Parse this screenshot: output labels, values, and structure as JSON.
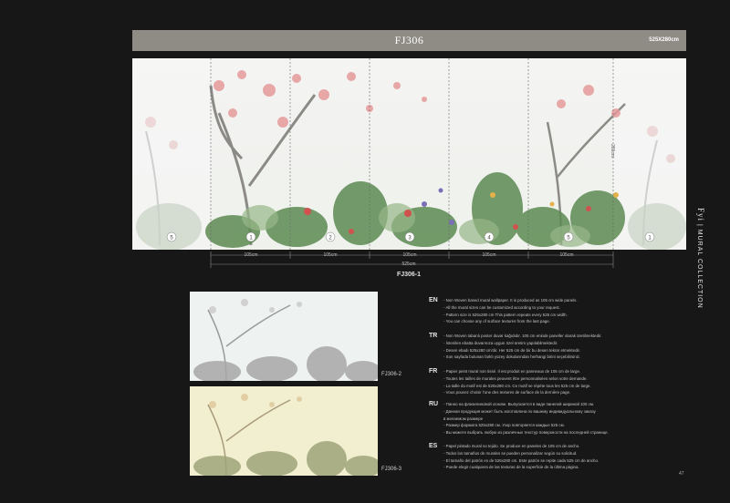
{
  "header": {
    "title": "FJ306",
    "size": "525X280cm"
  },
  "mural": {
    "panel_markers": [
      "5",
      "1",
      "2",
      "3",
      "4",
      "5",
      "1"
    ],
    "height_label": "280cm",
    "panel_widths": [
      "105cm",
      "105cm",
      "105cm",
      "105cm",
      "105cm"
    ],
    "total_width": "525cm",
    "code": "FJ306-1"
  },
  "variants": [
    {
      "code": "FJ306-2"
    },
    {
      "code": "FJ306-3"
    }
  ],
  "brand": {
    "name": "Fyi",
    "separator": "|",
    "collection": "MURAL COLLECTION"
  },
  "descriptions": [
    {
      "code": "EN",
      "lines": [
        "- Non Woven based mural wallpaper. It is produced as 105 cm wide panels.",
        "- All the mural sizes can be customized according to  your request.",
        "- Pattern size is 525x280 cm  This pattern repeats every 525 cm width.",
        "- You can choose any of surface textures from  the last page."
      ]
    },
    {
      "code": "TR",
      "lines": [
        "- Non Woven tabanlı poster duvar kağıdıdır. 105 cm eninde paneller olarak üretilmektedir.",
        "- İstenilen ebatta duvarınıza uygun  özel üretim yapılabilmektedir.",
        "- Desen ebadı 525x280 cm'dir.  Her 525 cm de bir bu desen tekrar etmektedir.",
        "- Son sayfada bulunan farklı yüzey dokularından herhangi birini seçebilirsiniz."
      ]
    },
    {
      "code": "FR",
      "lines": [
        "- Papier peint mural non tissé. Il est produit en panneaux de 105 cm de large.",
        "- Toutes les tailles de murales peuvent être personnalisées selon votre demande.",
        "- La taille du motif est de 525x280 cm. Ce motif se répète tous les 525 cm de large.",
        "- Vous pouvez choisir l'une des textures de surface de la dernière page."
      ]
    },
    {
      "code": "RU",
      "lines": [
        "- Панно на флизелиновой основе. Выпускается в виде панелей шириной 105 см.",
        "- Данная продукция может быть изготовлена по вашему индивидуальному заказу",
        "  в желаемом размере",
        "- Размер формата 525x280 см. Узор повторяется каждые 525 см.",
        "- Вы можете выбрать любую из различных текстур поверхности на последней странице."
      ]
    },
    {
      "code": "ES",
      "lines": [
        "- Papel pintado mural no tejido.  Se produce en paneles de 105 cm de ancho.",
        "- Todos los tamaños de murales se pueden personalizar según su solicitud.",
        "- El tamaño del patrón es de 525x280 cm. Este patrón se repite cada 525 cm de ancho.",
        "- Puede elegir cualquiera de las texturas de la superficie de la última página."
      ]
    }
  ],
  "page_number": "47"
}
